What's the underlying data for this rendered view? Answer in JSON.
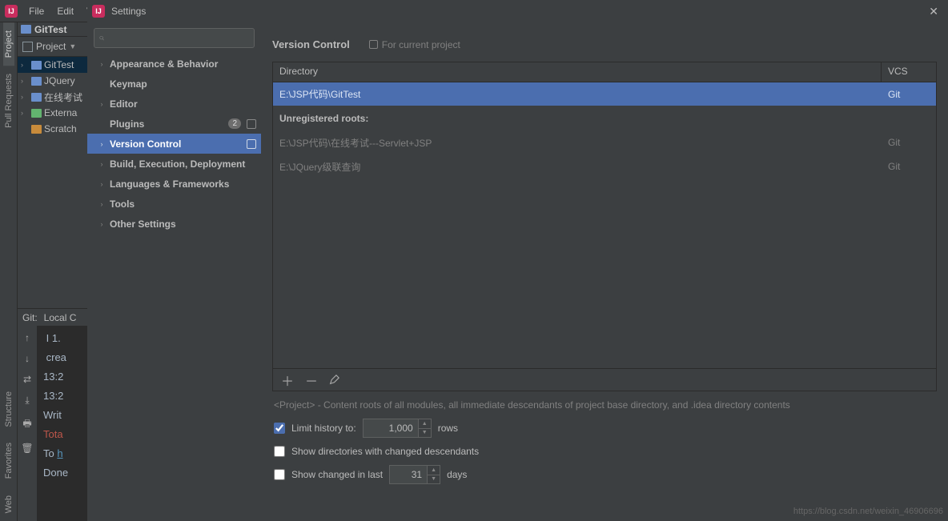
{
  "menubar": {
    "items": [
      "File",
      "Edit",
      "V"
    ]
  },
  "crumb": {
    "project": "GitTest"
  },
  "projectTool": {
    "label": "Project"
  },
  "projectTree": {
    "items": [
      {
        "label": "GitTest",
        "sel": true
      },
      {
        "label": "JQuery"
      },
      {
        "label": "在线考试"
      },
      {
        "label": "Externa"
      },
      {
        "label": "Scratch"
      }
    ]
  },
  "sidebarTabs": {
    "project": "Project",
    "structure": "Structure",
    "favorites": "Favorites",
    "pull": "Pull Requests",
    "web": "Web"
  },
  "gitTabs": {
    "git": "Git:",
    "local": "Local C"
  },
  "gitLog": {
    "l1": " I 1.",
    "l2": " crea",
    "l3": "13:2",
    "l4": "13:2",
    "l5": "Writ",
    "l6": "Tota",
    "l7": "To ",
    "l7b": "h",
    "l8": "",
    "l9": "Done"
  },
  "settings": {
    "title": "Settings",
    "search_placeholder": "",
    "tree": {
      "appearance": "Appearance & Behavior",
      "keymap": "Keymap",
      "editor": "Editor",
      "plugins": "Plugins",
      "plugins_badge": "2",
      "versionControl": "Version Control",
      "build": "Build, Execution, Deployment",
      "languages": "Languages & Frameworks",
      "tools": "Tools",
      "other": "Other Settings"
    },
    "right": {
      "heading": "Version Control",
      "forCurrent": "For current project",
      "colDirectory": "Directory",
      "colVcs": "VCS",
      "rows": [
        {
          "dir": "E:\\JSP代码\\GitTest",
          "vcs": "Git",
          "sel": true
        }
      ],
      "unregHeader": "Unregistered roots:",
      "unregRows": [
        {
          "dir": "E:\\JSP代码\\在线考试---Servlet+JSP",
          "vcs": "Git"
        },
        {
          "dir": "E:\\JQuery级联查询",
          "vcs": "Git"
        }
      ],
      "note": "<Project> - Content roots of all modules, all immediate descendants of project base directory, and .idea directory contents",
      "limitHistoryLabel": "Limit history to:",
      "limitHistoryValue": "1,000",
      "rowsLabel": "rows",
      "showDirLabel": "Show directories with changed descendants",
      "showChangedLabel": "Show changed in last",
      "showChangedValue": "31",
      "daysLabel": "days"
    }
  },
  "watermark": "https://blog.csdn.net/weixin_46906696"
}
